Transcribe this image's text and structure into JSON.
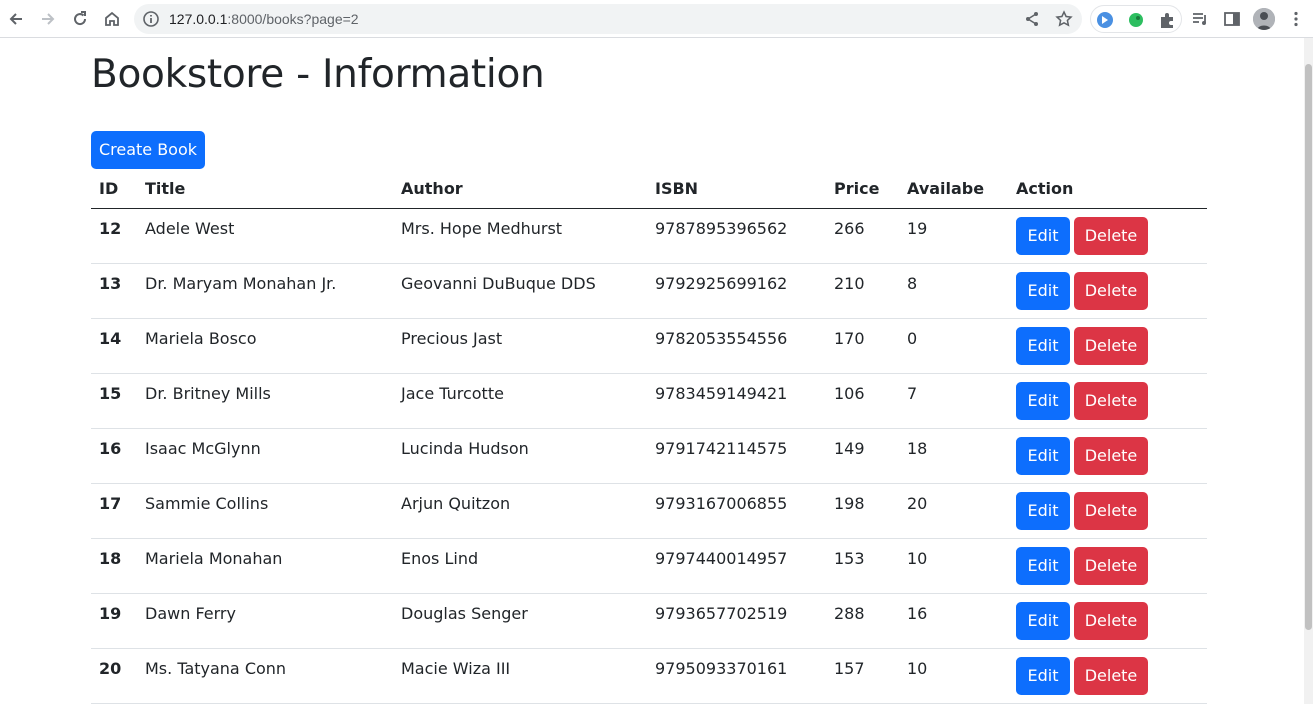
{
  "browser": {
    "url_host": "127.0.0.1",
    "url_rest": ":8000/books?page=2"
  },
  "page": {
    "title": "Bookstore - Information",
    "create_label": "Create Book"
  },
  "table": {
    "headers": [
      "ID",
      "Title",
      "Author",
      "ISBN",
      "Price",
      "Availabe",
      "Action"
    ],
    "edit_label": "Edit",
    "delete_label": "Delete",
    "rows": [
      {
        "id": "12",
        "title": "Adele West",
        "author": "Mrs. Hope Medhurst",
        "isbn": "9787895396562",
        "price": "266",
        "available": "19"
      },
      {
        "id": "13",
        "title": "Dr. Maryam Monahan Jr.",
        "author": "Geovanni DuBuque DDS",
        "isbn": "9792925699162",
        "price": "210",
        "available": "8"
      },
      {
        "id": "14",
        "title": "Mariela Bosco",
        "author": "Precious Jast",
        "isbn": "9782053554556",
        "price": "170",
        "available": "0"
      },
      {
        "id": "15",
        "title": "Dr. Britney Mills",
        "author": "Jace Turcotte",
        "isbn": "9783459149421",
        "price": "106",
        "available": "7"
      },
      {
        "id": "16",
        "title": "Isaac McGlynn",
        "author": "Lucinda Hudson",
        "isbn": "9791742114575",
        "price": "149",
        "available": "18"
      },
      {
        "id": "17",
        "title": "Sammie Collins",
        "author": "Arjun Quitzon",
        "isbn": "9793167006855",
        "price": "198",
        "available": "20"
      },
      {
        "id": "18",
        "title": "Mariela Monahan",
        "author": "Enos Lind",
        "isbn": "9797440014957",
        "price": "153",
        "available": "10"
      },
      {
        "id": "19",
        "title": "Dawn Ferry",
        "author": "Douglas Senger",
        "isbn": "9793657702519",
        "price": "288",
        "available": "16"
      },
      {
        "id": "20",
        "title": "Ms. Tatyana Conn",
        "author": "Macie Wiza III",
        "isbn": "9795093370161",
        "price": "157",
        "available": "10"
      }
    ]
  },
  "colors": {
    "primary": "#0d6efd",
    "danger": "#dc3545"
  }
}
